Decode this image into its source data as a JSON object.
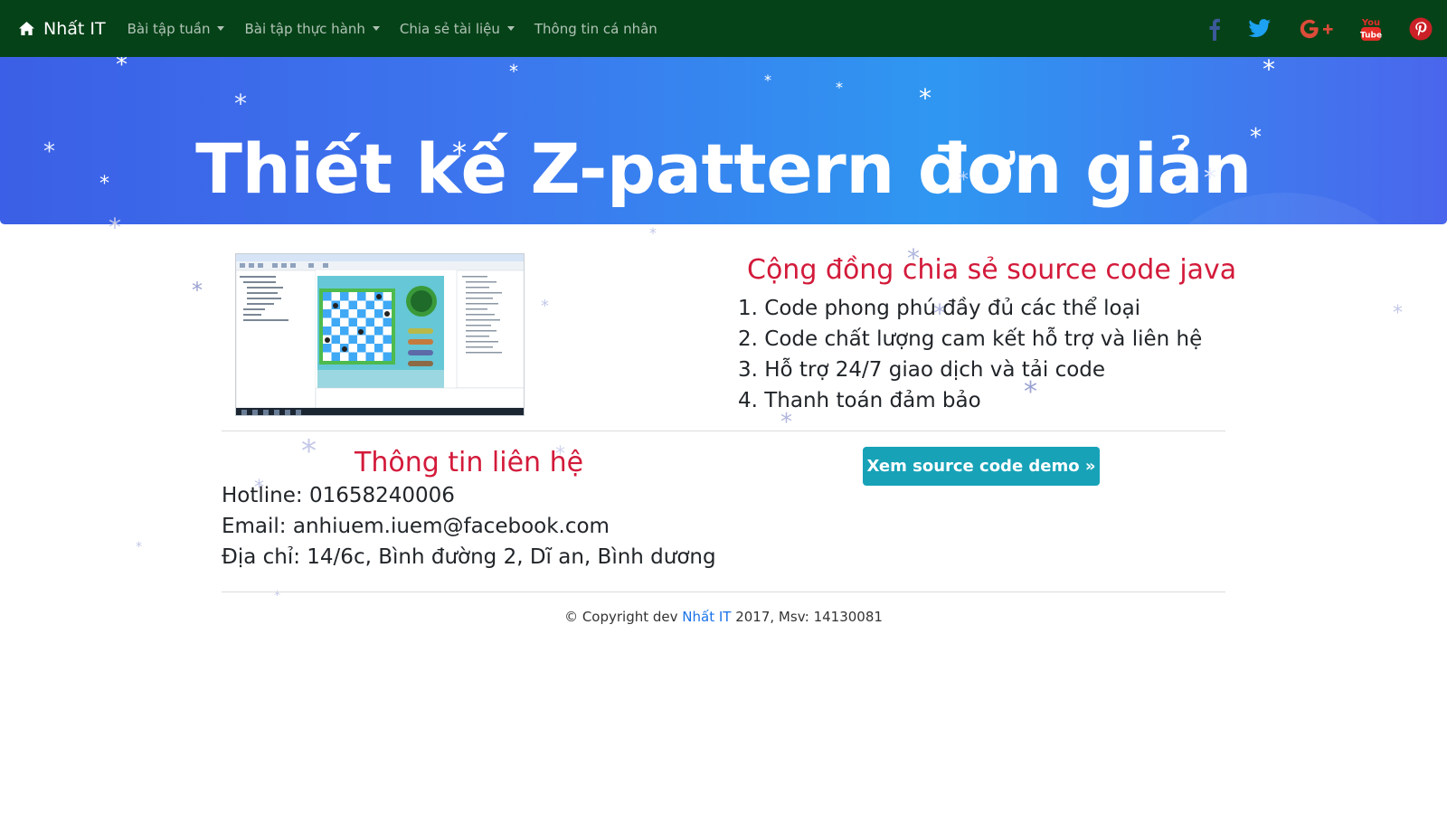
{
  "navbar": {
    "brand": "Nhất IT",
    "brand_icon": "home-icon",
    "items": [
      {
        "label": "Bài tập tuần",
        "dropdown": true
      },
      {
        "label": "Bài tập thực hành",
        "dropdown": true
      },
      {
        "label": "Chia sẻ tài liệu",
        "dropdown": true
      },
      {
        "label": "Thông tin cá nhân",
        "dropdown": false
      }
    ],
    "social": [
      "facebook-icon",
      "twitter-icon",
      "google-plus-icon",
      "youtube-icon",
      "pinterest-icon"
    ]
  },
  "hero": {
    "title": "Thiết kế Z-pattern đơn giản"
  },
  "community": {
    "title": "Cộng đồng chia sẻ source code java",
    "features": [
      "1. Code phong phú đầy đủ các thể loại",
      "2. Code chất lượng cam kết hỗ trợ và liên hệ",
      "3. Hỗ trợ 24/7 giao dịch và tải code",
      "4. Thanh toán đảm bảo"
    ]
  },
  "contact": {
    "title": "Thông tin liên hệ",
    "hotline": "Hotline: 01658240006",
    "email": "Email: anhiuem.iuem@facebook.com",
    "address": "Địa chỉ: 14/6c, Bình đường 2, Dĩ an, Bình dương"
  },
  "demo_button": {
    "label": "Xem source code demo »"
  },
  "footer": {
    "prefix": "© Copyright dev ",
    "link": "Nhất IT",
    "suffix": " 2017, Msv: 14130081"
  },
  "colors": {
    "navbar_bg": "#064218",
    "accent_red": "#d31a3a",
    "button_bg": "#17a2b8",
    "facebook": "#3b5998",
    "twitter": "#1da1f2",
    "google_plus": "#dd4b39",
    "youtube": "#e52d27",
    "pinterest": "#cb2027"
  }
}
